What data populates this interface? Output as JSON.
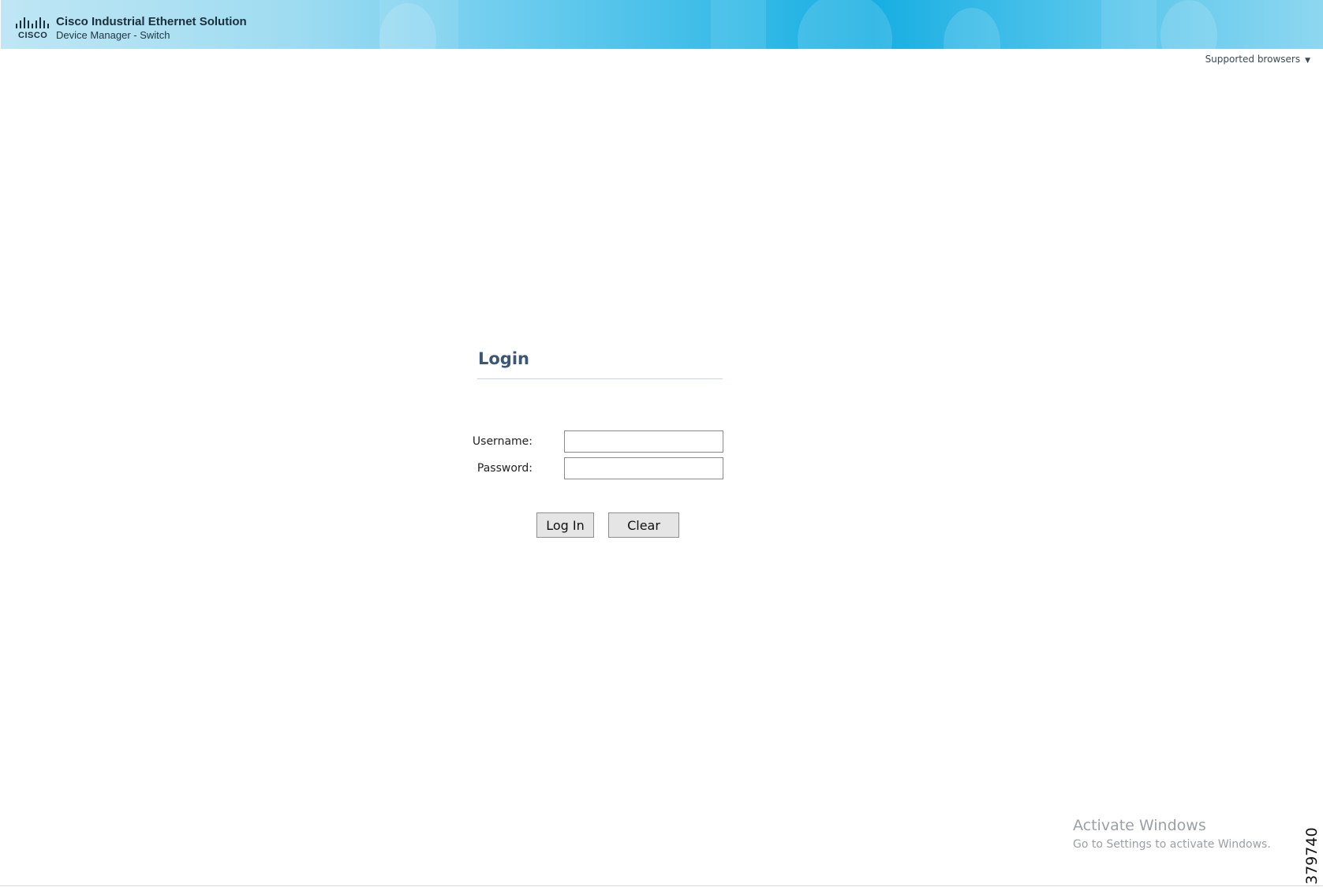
{
  "header": {
    "logo_word": "CISCO",
    "product_title": "Cisco Industrial Ethernet Solution",
    "product_subtitle": "Device Manager - Switch",
    "logo_icon": "cisco-bars-logo"
  },
  "supported_browsers": {
    "label": "Supported browsers",
    "caret_icon": "caret-down-icon"
  },
  "login": {
    "title": "Login",
    "username_label": "Username:",
    "username_value": "",
    "password_label": "Password:",
    "password_value": "",
    "login_button": "Log In",
    "clear_button": "Clear"
  },
  "watermark": {
    "title": "Activate Windows",
    "subtitle": "Go to Settings to activate Windows."
  },
  "figure_number": "379740",
  "colors": {
    "title_blue": "#3d5671",
    "header_cyan": "#17aee2"
  }
}
